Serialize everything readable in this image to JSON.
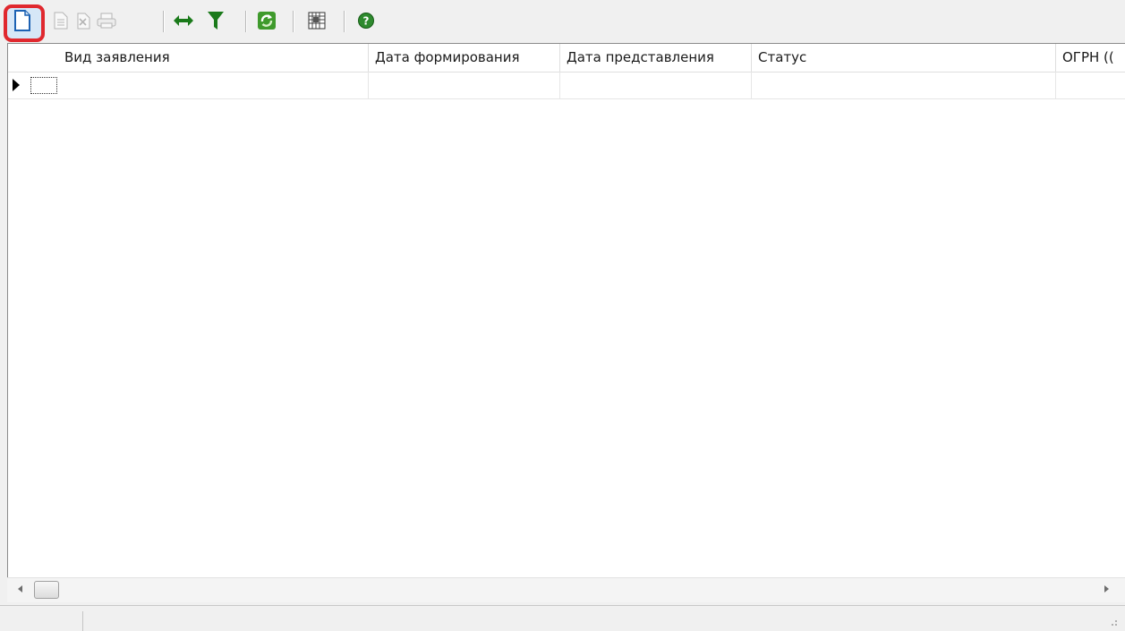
{
  "toolbar": {
    "buttons": [
      {
        "name": "new-document-icon",
        "enabled": true
      },
      {
        "name": "edit-document-icon",
        "enabled": false
      },
      {
        "name": "delete-document-icon",
        "enabled": false
      },
      {
        "name": "print-icon",
        "enabled": false
      },
      {
        "name": "fit-columns-icon",
        "enabled": true
      },
      {
        "name": "filter-icon",
        "enabled": true
      },
      {
        "name": "refresh-icon",
        "enabled": true
      },
      {
        "name": "grid-settings-icon",
        "enabled": true
      },
      {
        "name": "help-icon",
        "enabled": true
      }
    ],
    "highlight_color": "#e0282e"
  },
  "grid": {
    "columns": [
      {
        "label": "Вид заявления"
      },
      {
        "label": "Дата формирования"
      },
      {
        "label": "Дата представления"
      },
      {
        "label": "Статус"
      },
      {
        "label": "ОГРН (("
      }
    ],
    "rows": [
      {
        "cells": [
          "",
          "",
          "",
          "",
          ""
        ]
      }
    ]
  },
  "colors": {
    "accent_green": "#1a7a1a",
    "highlight_red": "#e0282e"
  }
}
